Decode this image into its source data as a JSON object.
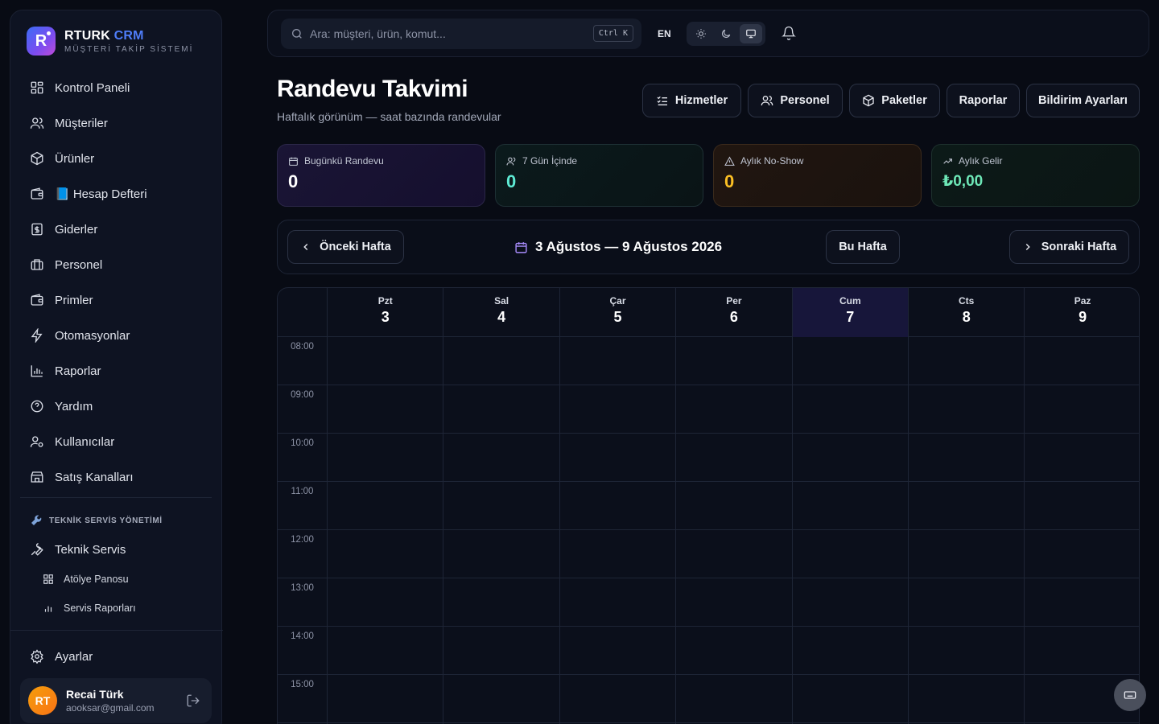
{
  "brand": {
    "name_main": "RTURK",
    "name_accent": "CRM",
    "subtitle": "MÜŞTERİ TAKİP SİSTEMİ",
    "logo_letter": "R"
  },
  "sidebar": {
    "items": [
      {
        "label": "Kontrol Paneli",
        "icon": "dashboard-icon"
      },
      {
        "label": "Müşteriler",
        "icon": "users-icon"
      },
      {
        "label": "Ürünler",
        "icon": "package-icon"
      },
      {
        "label": "📘 Hesap Defteri",
        "icon": "wallet-icon"
      },
      {
        "label": "Giderler",
        "icon": "receipt-icon"
      },
      {
        "label": "Personel",
        "icon": "briefcase-icon"
      },
      {
        "label": "Primler",
        "icon": "wallet-icon"
      },
      {
        "label": "Otomasyonlar",
        "icon": "lightning-icon"
      },
      {
        "label": "Raporlar",
        "icon": "bar-chart-icon"
      },
      {
        "label": "Yardım",
        "icon": "help-icon"
      },
      {
        "label": "Kullanıcılar",
        "icon": "user-cog-icon"
      },
      {
        "label": "Satış Kanalları",
        "icon": "store-icon"
      }
    ],
    "section_title": "TEKNİK SERVİS YÖNETİMİ",
    "service": {
      "label": "Teknik Servis"
    },
    "sub_items": [
      {
        "label": "Atölye Panosu"
      },
      {
        "label": "Servis Raporları"
      }
    ],
    "settings": {
      "label": "Ayarlar"
    },
    "user": {
      "initials": "RT",
      "name": "Recai Türk",
      "email": "aooksar@gmail.com"
    }
  },
  "topbar": {
    "search_placeholder": "Ara: müşteri, ürün, komut...",
    "shortcut": "Ctrl K",
    "language": "EN",
    "theme_selected": "system"
  },
  "header": {
    "title": "Randevu Takvimi",
    "subtitle": "Haftalık görünüm — saat bazında randevular",
    "buttons": [
      "Hizmetler",
      "Personel",
      "Paketler",
      "Raporlar",
      "Bildirim Ayarları"
    ]
  },
  "stats": [
    {
      "label": "Bugünkü Randevu",
      "value": "0",
      "color": "#ffffff"
    },
    {
      "label": "7 Gün İçinde",
      "value": "0",
      "color": "#5eead4"
    },
    {
      "label": "Aylık No-Show",
      "value": "0",
      "color": "#fbbf24"
    },
    {
      "label": "Aylık Gelir",
      "value": "₺0,00",
      "color": "#6ee7b7"
    }
  ],
  "week_nav": {
    "prev": "Önceki Hafta",
    "range": "3 Ağustos — 9 Ağustos 2026",
    "this_week": "Bu Hafta",
    "next": "Sonraki Hafta"
  },
  "calendar": {
    "days": [
      {
        "name": "Pzt",
        "num": "3"
      },
      {
        "name": "Sal",
        "num": "4"
      },
      {
        "name": "Çar",
        "num": "5"
      },
      {
        "name": "Per",
        "num": "6"
      },
      {
        "name": "Cum",
        "num": "7"
      },
      {
        "name": "Cts",
        "num": "8"
      },
      {
        "name": "Paz",
        "num": "9"
      }
    ],
    "today_index": 4,
    "hours": [
      "08:00",
      "09:00",
      "10:00",
      "11:00",
      "12:00",
      "13:00",
      "14:00",
      "15:00"
    ]
  }
}
